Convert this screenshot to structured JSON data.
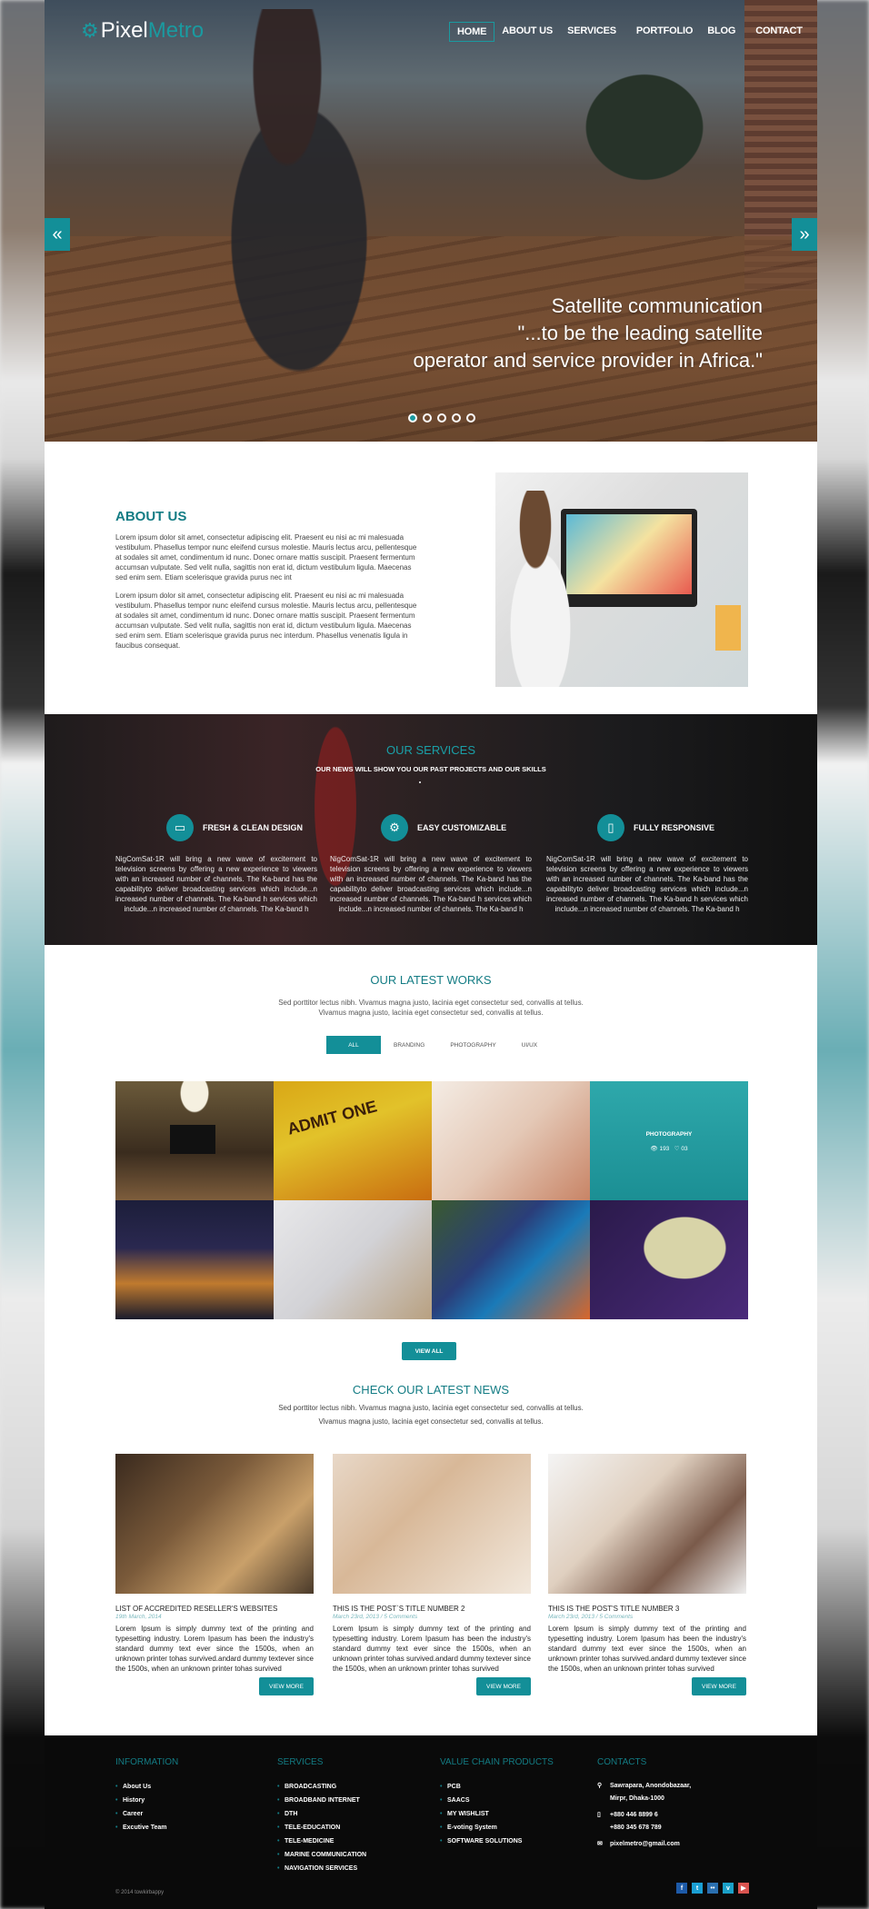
{
  "brand": {
    "logo_icon": "gear-icon",
    "name_part1": "Pixel",
    "name_part2": "Metro"
  },
  "nav": {
    "items": [
      {
        "label": "HOME",
        "active": true
      },
      {
        "label": "ABOUT US",
        "active": false
      },
      {
        "label": "SERVICES",
        "active": false
      },
      {
        "label": "PORTFOLIO",
        "active": false
      },
      {
        "label": "BLOG",
        "active": false
      },
      {
        "label": "CONTACT",
        "active": false
      }
    ]
  },
  "hero": {
    "prev_icon": "«",
    "next_icon": "»",
    "line1": "Satellite communication",
    "line2": "\"...to be the leading satellite",
    "line3": "operator and service provider in Africa.\"",
    "slides": 5,
    "active_slide": 1
  },
  "about": {
    "title": "ABOUT US",
    "p1": "Lorem ipsum dolor sit amet, consectetur adipiscing elit. Praesent eu nisi ac mi malesuada vestibulum. Phasellus tempor nunc eleifend cursus molestie. Mauris lectus arcu, pellentesque at sodales sit amet, condimentum id nunc. Donec ornare mattis suscipit. Praesent fermentum accumsan vulputate. Sed velit nulla, sagittis non erat id, dictum vestibulum ligula. Maecenas sed enim sem. Etiam scelerisque gravida purus nec int",
    "p2": "Lorem ipsum dolor sit amet, consectetur adipiscing elit. Praesent eu nisi ac mi malesuada vestibulum. Phasellus tempor nunc eleifend cursus molestie. Mauris lectus arcu, pellentesque at sodales sit amet, condimentum id nunc. Donec ornare mattis suscipit. Praesent fermentum accumsan vulputate. Sed velit nulla, sagittis non erat id, dictum vestibulum ligula. Maecenas sed enim sem. Etiam scelerisque gravida purus nec interdum. Phasellus venenatis ligula in faucibus consequat."
  },
  "services": {
    "title": "OUR SERVICES",
    "subtitle": "OUR NEWS WILL SHOW YOU OUR PAST PROJECTS AND OUR SKILLS",
    "items": [
      {
        "icon": "monitor-icon",
        "glyph": "▭",
        "title": "FRESH & CLEAN DESIGN",
        "text": "NigComSat-1R will bring a new wave of excitement to television screens by offering a new experience to viewers with an increased number of channels. The Ka-band has the capabilityto deliver broadcasting services which include...n increased number of channels. The Ka-band h services which include...n increased number of channels. The Ka-band h"
      },
      {
        "icon": "gear-icon",
        "glyph": "⚙",
        "title": "EASY CUSTOMIZABLE",
        "text": "NigComSat-1R will bring a new wave of excitement to television screens by offering a new experience to viewers with an increased number of channels. The Ka-band has the capabilityto deliver broadcasting services which include...n increased number of channels. The Ka-band h services which include...n increased number of channels. The Ka-band h"
      },
      {
        "icon": "tablet-icon",
        "glyph": "▯",
        "title": "FULLY RESPONSIVE",
        "text": "NigComSat-1R will bring a new wave of excitement to television screens by offering a new experience to viewers with an increased number of channels. The Ka-band has the capabilityto deliver broadcasting services which include...n increased number of channels. The Ka-band h services which include...n increased number of channels. The Ka-band h"
      }
    ]
  },
  "works": {
    "title": "OUR LATEST WORKS",
    "desc1": "Sed porttitor lectus nibh. Vivamus magna justo, lacinia eget consectetur sed, convallis at tellus.",
    "desc2": "Vivamus magna justo, lacinia eget consectetur sed, convallis at tellus.",
    "filters": [
      {
        "label": "ALL",
        "active": true
      },
      {
        "label": "BRANDING",
        "active": false
      },
      {
        "label": "PHOTOGRAPHY",
        "active": false
      },
      {
        "label": "UI/UX",
        "active": false
      }
    ],
    "overlay": {
      "category": "PHOTOGRAPHY",
      "views": "193",
      "likes": "03"
    },
    "tiles": [
      "home-theater",
      "admit-one-ticket",
      "hand-drawing",
      "photography-railway",
      "city-night-skyline",
      "wooden-mannequin-hand",
      "colorful-fish",
      "theater-masks"
    ],
    "view_all": "VIEW ALL"
  },
  "news": {
    "title": "CHECK OUR LATEST NEWS",
    "desc1": "Sed porttitor lectus nibh. Vivamus magna justo, lacinia eget consectetur sed, convallis at tellus.",
    "desc2": "Vivamus magna justo, lacinia eget consectetur sed, convallis at tellus.",
    "posts": [
      {
        "title": "LIST OF ACCREDITED RESELLER'S WEBSITES",
        "meta": "19th March, 2014",
        "text": "Lorem Ipsum is simply dummy text of the printing and typesetting industry. Lorem Ipasum has been the industry's standard dummy text ever since the 1500s, when an unknown printer tohas survived.andard dummy textever since the 1500s, when an unknown printer tohas survived",
        "button": "VIEW MORE"
      },
      {
        "title": "THIS IS THE POST`S TITLE NUMBER 2",
        "meta": "March 23rd, 2013 / 5 Comments",
        "text": "Lorem Ipsum is simply dummy text of the printing and typesetting industry. Lorem Ipasum has been the industry's standard dummy text ever since the 1500s, when an unknown printer tohas survived.andard dummy textever since the 1500s, when an unknown printer tohas survived",
        "button": "VIEW MORE"
      },
      {
        "title": "THIS IS THE POST'S TITLE NUMBER 3",
        "meta": "March 23rd, 2013 / 5 Comments",
        "text": "Lorem Ipsum is simply dummy text of the printing and typesetting industry. Lorem Ipasum has been the industry's standard dummy text ever since the 1500s, when an unknown printer tohas survived.andard dummy textever since the 1500s, when an unknown printer tohas survived",
        "button": "VIEW MORE"
      }
    ]
  },
  "footer": {
    "information": {
      "title": "INFORMATION",
      "items": [
        "About Us",
        "History",
        "Career",
        "Excutive Team"
      ]
    },
    "services": {
      "title": "SERVICES",
      "items": [
        "BROADCASTING",
        "BROADBAND INTERNET",
        "DTH",
        "TELE-EDUCATION",
        "TELE-MEDICINE",
        "MARINE COMMUNICATION",
        "NAVIGATION SERVICES"
      ]
    },
    "value_chain": {
      "title": "VALUE CHAIN PRODUCTS",
      "items": [
        "PCB",
        "SAACS",
        "MY WISHLIST",
        "E-voting System",
        "SOFTWARE SOLUTIONS"
      ]
    },
    "contacts": {
      "title": "CONTACTS",
      "address1": "Sawrapara, Anondobazaar,",
      "address2": "Mirpr, Dhaka-1000",
      "phone1": "+880  446 8899 6",
      "phone2": "+880 345 678 789",
      "email": "pixelmetro@gmail.com"
    },
    "copyright": "© 2014 towkirbappy",
    "social": [
      {
        "name": "facebook-icon",
        "glyph": "f",
        "color": "#1d5aa8"
      },
      {
        "name": "twitter-icon",
        "glyph": "t",
        "color": "#1a9fd4"
      },
      {
        "name": "flickr-icon",
        "glyph": "••",
        "color": "#2a6fb0"
      },
      {
        "name": "vimeo-icon",
        "glyph": "v",
        "color": "#1aa0c8"
      },
      {
        "name": "youtube-icon",
        "glyph": "▶",
        "color": "#d9534f"
      }
    ]
  }
}
